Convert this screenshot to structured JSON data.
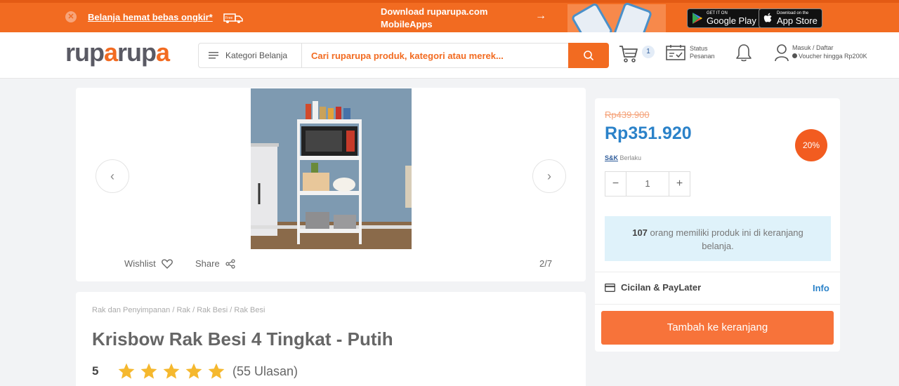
{
  "promo": {
    "free_shipping_text": "Belanja hemat bebas ongkir*",
    "truck_label": "Free",
    "download_line1": "Download ruparupa.com",
    "download_line2": "MobileApps",
    "google_play_small": "GET IT ON",
    "google_play_big": "Google Play",
    "app_store_small": "Download on the",
    "app_store_big": "App Store"
  },
  "header": {
    "logo_part1": "rup",
    "logo_part2": "a",
    "logo_part3": "rup",
    "logo_part4": "a",
    "category_label": "Kategori Belanja",
    "search_placeholder": "Cari ruparupa produk, kategori atau merek...",
    "cart_count": "1",
    "status_line1": "Status",
    "status_line2": "Pesanan",
    "account_line1": "Masuk / Daftar",
    "account_line2": "Voucher hingga Rp200K"
  },
  "gallery": {
    "wishlist_label": "Wishlist",
    "share_label": "Share",
    "counter": "2/7",
    "prev_arrow": "‹",
    "next_arrow": "›"
  },
  "product": {
    "breadcrumb": "Rak dan Penyimpanan / Rak / Rak Besi / Rak Besi",
    "title": "Krisbow Rak Besi 4 Tingkat - Putih",
    "rating": "5",
    "stars": 5,
    "reviews": "(55 Ulasan)"
  },
  "panel": {
    "old_price": "Rp439.900",
    "price": "Rp351.920",
    "discount": "20%",
    "tnc_link": "S&K",
    "tnc_text": "Berlaku",
    "qty_minus": "−",
    "qty_value": "1",
    "qty_plus": "+",
    "notice_count": "107",
    "notice_text": "orang memiliki produk ini di keranjang belanja.",
    "cicilan_label": "Cicilan & PayLater",
    "info_link": "Info",
    "add_to_cart": "Tambah ke keranjang"
  },
  "colors": {
    "brand_orange": "#f26b21",
    "price_blue": "#2b82c9",
    "star_yellow": "#f5b82e"
  }
}
